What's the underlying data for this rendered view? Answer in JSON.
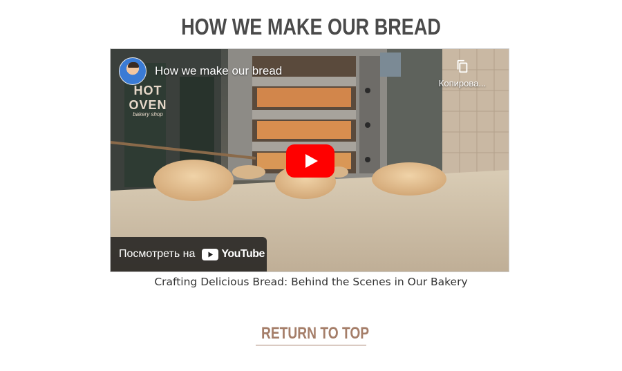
{
  "section": {
    "heading": "HOW WE MAKE OUR BREAD"
  },
  "video": {
    "title": "How we make our bread",
    "brand_logo": {
      "name": "HOT OVEN",
      "tagline": "bakery shop"
    },
    "copy_label": "Копирова...",
    "watch_on_label": "Посмотреть на",
    "platform_label": "YouTube",
    "play_color": "#ff0000"
  },
  "caption": "Crafting Delicious Bread: Behind the Scenes in Our Bakery",
  "return_to_top": {
    "label": "RETURN TO TOP",
    "color": "#a57e69"
  }
}
